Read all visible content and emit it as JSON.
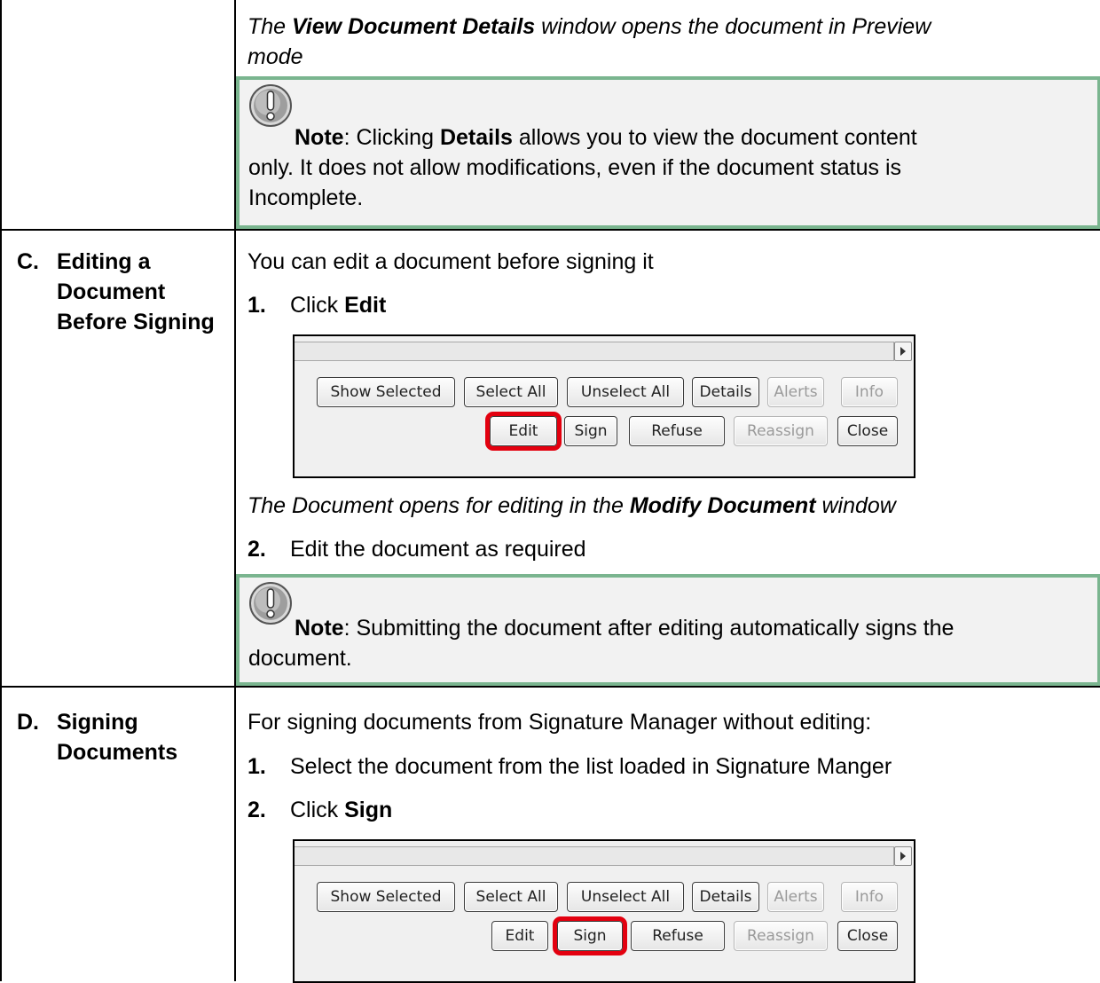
{
  "row1": {
    "preview_line1": "The ",
    "preview_bold": "View Document Details",
    "preview_line1_rest": " window opens the document in Preview",
    "preview_line2": "mode",
    "note": {
      "label": "Note",
      "text1": ": Clicking ",
      "bold": "Details",
      "text2": " allows you to view the document content",
      "line2": "only. It does not allow modifications, even if the document status is",
      "line3": "Incomplete."
    }
  },
  "sectionC": {
    "letter": "C.",
    "title": "Editing a Document Before Signing",
    "intro": "You can edit a document before signing it",
    "step1_num": "1.",
    "step1_text": "Click ",
    "step1_bold": "Edit",
    "result_text1": "The Document opens for editing in the ",
    "result_bold": "Modify Document",
    "result_text2": " window",
    "step2_num": "2.",
    "step2_text": "Edit the document as required",
    "note": {
      "label": "Note",
      "text1": ": Submitting the document after editing automatically signs the",
      "line2": "document."
    }
  },
  "sectionD": {
    "letter": "D.",
    "title": "Signing Documents",
    "intro": "For signing documents from Signature Manager without editing:",
    "step1_num": "1.",
    "step1_text": "Select the document from the list loaded in Signature Manger",
    "step2_num": "2.",
    "step2_text": "Click ",
    "step2_bold": "Sign"
  },
  "toolbar": {
    "show_selected": "Show Selected",
    "select_all": "Select All",
    "unselect_all": "Unselect All",
    "details": "Details",
    "alerts": "Alerts",
    "info": "Info",
    "edit": "Edit",
    "sign": "Sign",
    "refuse": "Refuse",
    "reassign": "Reassign",
    "close": "Close"
  },
  "colors": {
    "note_border": "#7ab58f",
    "note_bg": "#f2f2f2",
    "highlight": "#e3000f"
  }
}
